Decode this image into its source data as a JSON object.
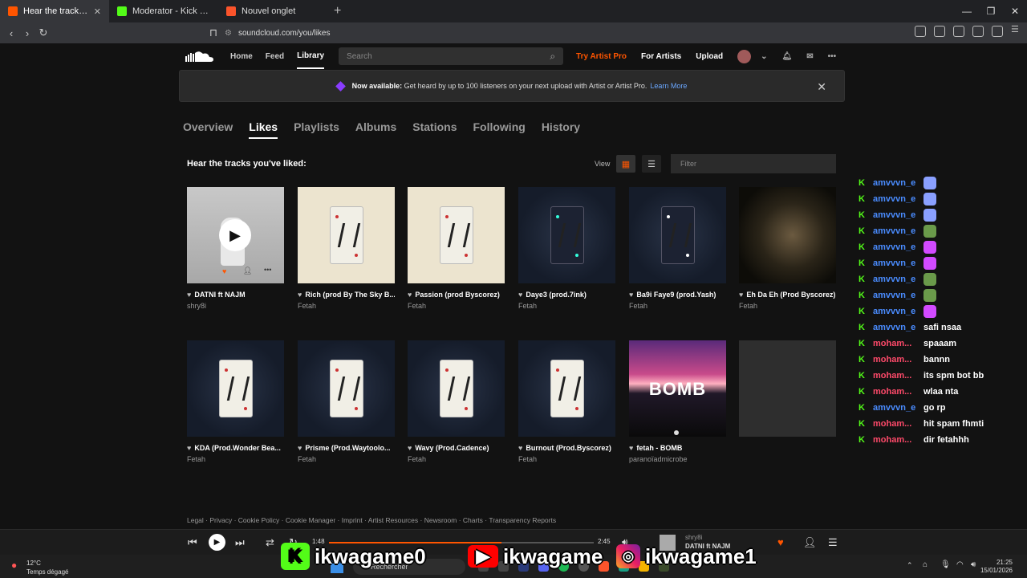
{
  "browser": {
    "tabs": [
      {
        "title": "Hear the tracks you've li",
        "favicon_color": "#ff5500",
        "active": true
      },
      {
        "title": "Moderator - Kick Dashboard",
        "favicon_color": "#53fc18",
        "active": false
      },
      {
        "title": "Nouvel onglet",
        "favicon_color": "#fb542b",
        "active": false
      }
    ],
    "url": "soundcloud.com/you/likes"
  },
  "header": {
    "nav": [
      "Home",
      "Feed",
      "Library"
    ],
    "search_placeholder": "Search",
    "try_pro": "Try Artist Pro",
    "for_artists": "For Artists",
    "upload": "Upload"
  },
  "banner": {
    "bold": "Now available:",
    "text": "Get heard by up to 100 listeners on your next upload with Artist or Artist Pro.",
    "link": "Learn More"
  },
  "subtabs": [
    "Overview",
    "Likes",
    "Playlists",
    "Albums",
    "Stations",
    "Following",
    "History"
  ],
  "likes": {
    "title": "Hear the tracks you've liked:",
    "view_label": "View",
    "filter_placeholder": "Filter"
  },
  "tracks": [
    {
      "title": "DATNI ft NAJM",
      "artist": "shry8i"
    },
    {
      "title": "Rich (prod By The Sky B...",
      "artist": "Fetah"
    },
    {
      "title": "Passion (prod Byscorez)",
      "artist": "Fetah"
    },
    {
      "title": "Daye3 (prod.7ink)",
      "artist": "Fetah"
    },
    {
      "title": "Ba9i Faye9 (prod.Yash)",
      "artist": "Fetah"
    },
    {
      "title": "Eh Da Eh (Prod Byscorez)",
      "artist": "Fetah"
    },
    {
      "title": "KDA (Prod.Wonder Bea...",
      "artist": "Fetah"
    },
    {
      "title": "Prisme (Prod.Waytoolo...",
      "artist": "Fetah"
    },
    {
      "title": "Wavy (Prod.Cadence)",
      "artist": "Fetah"
    },
    {
      "title": "Burnout (Prod.Byscorez)",
      "artist": "Fetah"
    },
    {
      "title": "fetah - BOMB",
      "artist": "paranoïadmicrobe",
      "art_text": "BOMB"
    }
  ],
  "footer": {
    "links": "Legal · Privacy · Cookie Policy · Cookie Manager · Imprint · Artist Resources · Newsroom · Charts · Transparency Reports"
  },
  "chat": [
    {
      "user": "amvvvn_e",
      "msg": "",
      "color": "#4a8cff",
      "emote": "#8aa0ff"
    },
    {
      "user": "amvvvn_e",
      "msg": "",
      "color": "#4a8cff",
      "emote": "#8aa0ff"
    },
    {
      "user": "amvvvn_e",
      "msg": "",
      "color": "#4a8cff",
      "emote": "#8aa0ff"
    },
    {
      "user": "amvvvn_e",
      "msg": "",
      "color": "#4a8cff",
      "emote": "#6a9a4a"
    },
    {
      "user": "amvvvn_e",
      "msg": "",
      "color": "#4a8cff",
      "emote": "#d24aff"
    },
    {
      "user": "amvvvn_e",
      "msg": "",
      "color": "#4a8cff",
      "emote": "#d24aff"
    },
    {
      "user": "amvvvn_e",
      "msg": "",
      "color": "#4a8cff",
      "emote": "#6a9a4a"
    },
    {
      "user": "amvvvn_e",
      "msg": "",
      "color": "#4a8cff",
      "emote": "#6a9a4a"
    },
    {
      "user": "amvvvn_e",
      "msg": "",
      "color": "#4a8cff",
      "emote": "#d24aff"
    },
    {
      "user": "amvvvn_e",
      "msg": "safi nsaa",
      "color": "#4a8cff"
    },
    {
      "user": "moham...",
      "msg": "spaaam",
      "color": "#ff4a6a"
    },
    {
      "user": "moham...",
      "msg": "bannn",
      "color": "#ff4a6a"
    },
    {
      "user": "moham...",
      "msg": "its spm bot bb",
      "color": "#ff4a6a"
    },
    {
      "user": "moham...",
      "msg": "wlaa nta",
      "color": "#ff4a6a"
    },
    {
      "user": "amvvvn_e",
      "msg": "go rp",
      "color": "#4a8cff"
    },
    {
      "user": "moham...",
      "msg": "hit spam fhmti",
      "color": "#ff4a6a"
    },
    {
      "user": "moham...",
      "msg": "dir fetahhh",
      "color": "#ff4a6a"
    }
  ],
  "player": {
    "elapsed": "1:48",
    "duration": "2:45",
    "progress_fraction": 0.65,
    "artist": "shry8i",
    "title": "DATNI ft NAJM"
  },
  "taskbar": {
    "temp": "12°C",
    "weather": "Temps dégagé",
    "search": "Rechercher",
    "time": "21:25",
    "date": "15/01/2026"
  },
  "social": {
    "kick": "ikwagame0",
    "youtube": "ikwagame",
    "instagram": "ikwagame1"
  }
}
